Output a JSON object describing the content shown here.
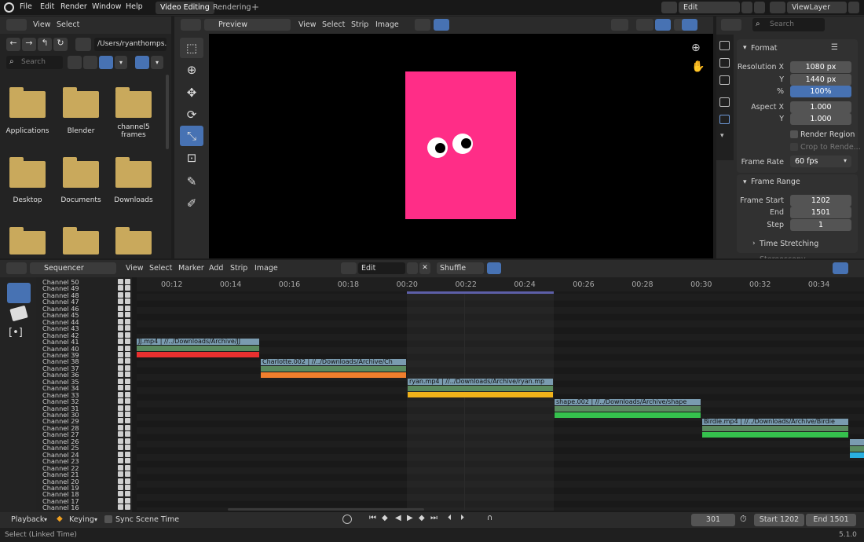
{
  "topbar": {
    "menus": [
      "File",
      "Edit",
      "Render",
      "Window",
      "Help"
    ],
    "tabs": [
      {
        "label": "Video Editing",
        "active": true
      },
      {
        "label": "Rendering",
        "active": false
      }
    ],
    "add_tab": "+",
    "scene_label": "Edit",
    "view_layer": "ViewLayer"
  },
  "file_browser": {
    "menus": [
      "View",
      "Select"
    ],
    "path": "/Users/ryanthomps...",
    "search_placeholder": "Search",
    "folders": [
      {
        "label": "Applications"
      },
      {
        "label": "Blender"
      },
      {
        "label": "channel5 frames"
      },
      {
        "label": "Desktop"
      },
      {
        "label": "Documents"
      },
      {
        "label": "Downloads"
      },
      {
        "label": ""
      },
      {
        "label": ""
      },
      {
        "label": ""
      }
    ]
  },
  "preview": {
    "mode": "Preview",
    "menus": [
      "View",
      "Select",
      "Strip",
      "Image"
    ],
    "colors": {
      "background": "#000000",
      "card": "#ff2d87"
    }
  },
  "properties": {
    "search_placeholder": "Search",
    "format_title": "Format",
    "resolution_x_label": "Resolution X",
    "resolution_x": "1080 px",
    "y_label": "Y",
    "resolution_y": "1440 px",
    "percent_label": "%",
    "percent": "100%",
    "aspect_x_label": "Aspect X",
    "aspect_x": "1.000",
    "aspect_y_label": "Y",
    "aspect_y": "1.000",
    "render_region": "Render Region",
    "crop_to_render": "Crop to Rende...",
    "frame_rate_label": "Frame Rate",
    "frame_rate": "60 fps",
    "frame_range_title": "Frame Range",
    "frame_start_label": "Frame Start",
    "frame_start": "1202",
    "end_label": "End",
    "frame_end": "1501",
    "step_label": "Step",
    "step": "1",
    "time_stretching": "Time Stretching",
    "cut_label": "Stereoscopy"
  },
  "sequencer": {
    "editor": "Sequencer",
    "menus": [
      "View",
      "Select",
      "Marker",
      "Add",
      "Strip",
      "Image"
    ],
    "scene": "Edit",
    "shuffle": "Shuffle",
    "ticks": [
      "00:12",
      "00:14",
      "00:16",
      "00:18",
      "00:20",
      "00:22",
      "00:24",
      "00:26",
      "00:28",
      "00:30",
      "00:32",
      "00:34"
    ],
    "channels": [
      "Channel 50",
      "Channel 49",
      "Channel 48",
      "Channel 47",
      "Channel 46",
      "Channel 45",
      "Channel 44",
      "Channel 43",
      "Channel 42",
      "Channel 41",
      "Channel 40",
      "Channel 39",
      "Channel 38",
      "Channel 37",
      "Channel 36",
      "Channel 35",
      "Channel 34",
      "Channel 33",
      "Channel 32",
      "Channel 31",
      "Channel 30",
      "Channel 29",
      "Channel 28",
      "Channel 27",
      "Channel 26",
      "Channel 25",
      "Channel 24",
      "Channel 23",
      "Channel 22",
      "Channel 21",
      "Channel 20",
      "Channel 19",
      "Channel 18",
      "Channel 17",
      "Channel 16"
    ],
    "strips": [
      {
        "label": "JJ.mp4 | //../Downloads/Archive/JJ",
        "color": "#e8302f"
      },
      {
        "label": "Charlotte.002 | //../Downloads/Archive/Ch",
        "color": "#f07f2d"
      },
      {
        "label": "ryan.mp4 | //../Downloads/Archive/ryan.mp",
        "color": "#f0b21a"
      },
      {
        "label": "shape.002 | //../Downloads/Archive/shape",
        "color": "#35c14d"
      },
      {
        "label": "Birdie.mp4 | //../Downloads/Archive/Birdie",
        "color": "#35c14d"
      },
      {
        "label": "",
        "color": "#2ab0e0"
      }
    ]
  },
  "playback": {
    "playback": "Playback",
    "keying": "Keying",
    "sync": "Sync Scene Time",
    "current_frame": "301",
    "start": "Start  1202",
    "end": "End  1501"
  },
  "status": {
    "left": "Select (Linked Time)",
    "version": "5.1.0"
  }
}
